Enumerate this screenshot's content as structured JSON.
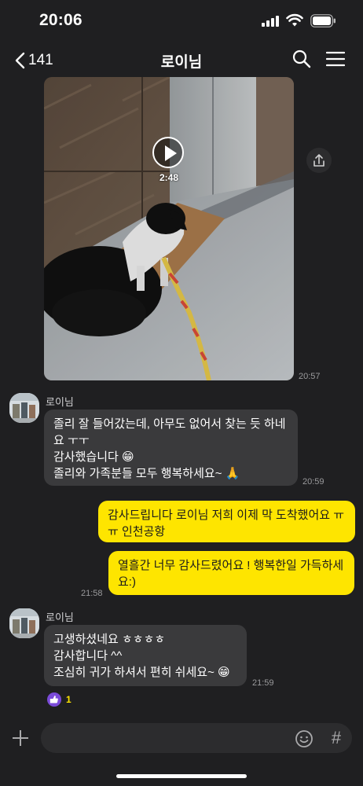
{
  "status_bar": {
    "time": "20:06",
    "icons": [
      "signal-icon",
      "wifi-icon",
      "battery-icon"
    ]
  },
  "header": {
    "back_count": "141",
    "title": "로이님",
    "icons": [
      "chevron-left-icon",
      "search-icon",
      "hamburger-menu-icon"
    ]
  },
  "video_message": {
    "duration": "2:48",
    "time": "20:57",
    "icons": [
      "play-icon",
      "share-icon"
    ]
  },
  "messages": [
    {
      "sender": "로이님",
      "text": "졸리 잘 들어갔는데, 아무도 없어서 찾는 듯 하네\n요 ㅜㅜ\n감사했습니다 😁\n졸리와 가족분들 모두 행복하세요~ 🙏",
      "time": "20:59"
    },
    {
      "text": "감사드립니다 로이님 저희 이제 막 도착했어요 ㅠ\nㅠ 인천공항"
    },
    {
      "text": "열흘간 너무 감사드렸어요 ! 행복한일 가득하세\n요:)",
      "time": "21:58"
    },
    {
      "sender": "로이님",
      "text": "고생하셨네요 ㅎㅎㅎㅎ\n감사합니다 ^^\n조심히 귀가 하셔서 편히 쉬세요~ 😁",
      "time": "21:59",
      "reaction": {
        "icon": "thumbs-up-icon",
        "count": "1"
      }
    }
  ],
  "input_bar": {
    "placeholder": "",
    "icons": [
      "plus-icon",
      "emoji-icon",
      "hash-icon"
    ]
  },
  "colors": {
    "background": "#1f1f21",
    "incoming_bubble": "#3a3a3c",
    "outgoing_bubble": "#fee500",
    "reaction": "#7a4ad8"
  }
}
